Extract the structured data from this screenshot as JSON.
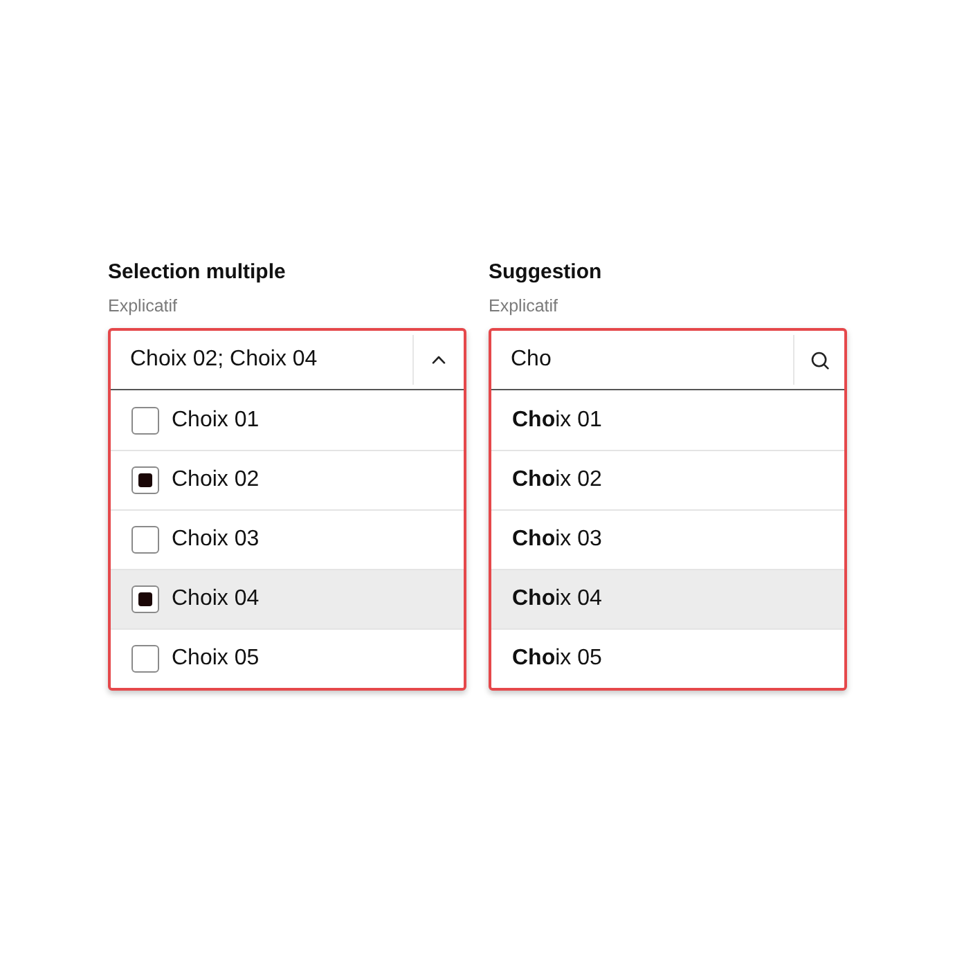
{
  "fields": [
    {
      "kind": "multiselect",
      "label": "Selection multiple",
      "hint": "Explicatif",
      "value": "Choix 02; Choix 04",
      "expanded": true,
      "options": [
        {
          "label": "Choix 01",
          "checked": false,
          "highlighted": false
        },
        {
          "label": "Choix 02",
          "checked": true,
          "highlighted": false
        },
        {
          "label": "Choix 03",
          "checked": false,
          "highlighted": false
        },
        {
          "label": "Choix 04",
          "checked": true,
          "highlighted": true
        },
        {
          "label": "Choix 05",
          "checked": false,
          "highlighted": false
        }
      ]
    },
    {
      "kind": "autocomplete",
      "label": "Suggestion",
      "hint": "Explicatif",
      "value": "Cho",
      "options": [
        {
          "label": "**Cho**ix 01",
          "highlighted": false
        },
        {
          "label": "**Cho**ix 02",
          "highlighted": false
        },
        {
          "label": "**Cho**ix 03",
          "highlighted": false
        },
        {
          "label": "**Cho**ix 04",
          "highlighted": true
        },
        {
          "label": "**Cho**ix 05",
          "highlighted": false
        }
      ]
    }
  ]
}
